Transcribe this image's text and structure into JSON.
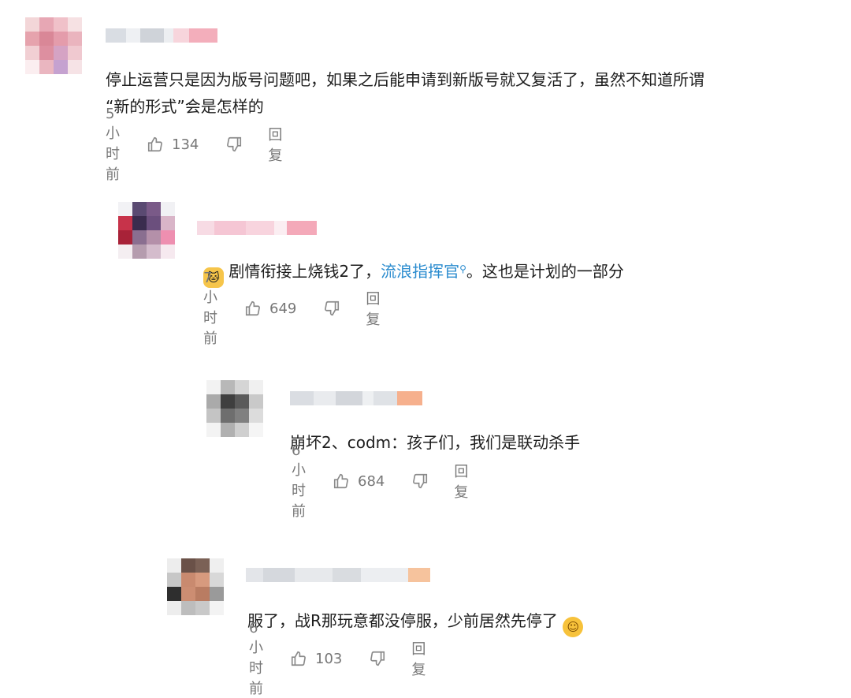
{
  "comments": [
    {
      "text": "停止运营只是因为版号问题吧，如果之后能申请到新版号就又复活了，虽然不知道所谓",
      "text2": "“新的形式”会是怎样的",
      "time": "5小时前",
      "likes": "134",
      "reply": "回复"
    },
    {
      "text_a": "剧情衔接上烧钱2了，",
      "link": "流浪指挥官",
      "text_b": "。这也是计划的一部分",
      "time": "7小时前",
      "likes": "649",
      "reply": "回复"
    },
    {
      "text": "崩坏2、codm：孩子们，我们是联动杀手",
      "time": "6小时前",
      "likes": "684",
      "reply": "回复"
    },
    {
      "text": "服了，战R那玩意都没停服，少前居然先停了",
      "time": "6小时前",
      "likes": "103",
      "reply": "回复"
    }
  ],
  "icons": {
    "like": "thumbs-up-icon",
    "dislike": "thumbs-down-icon",
    "search_hint": "search-icon",
    "cat_emoji": "cat-emoji-icon",
    "sly_emoji": "smirk-emoji-icon"
  },
  "colors": {
    "link": "#2b8ccf",
    "meta": "#777777",
    "text": "#1d1d1d"
  }
}
